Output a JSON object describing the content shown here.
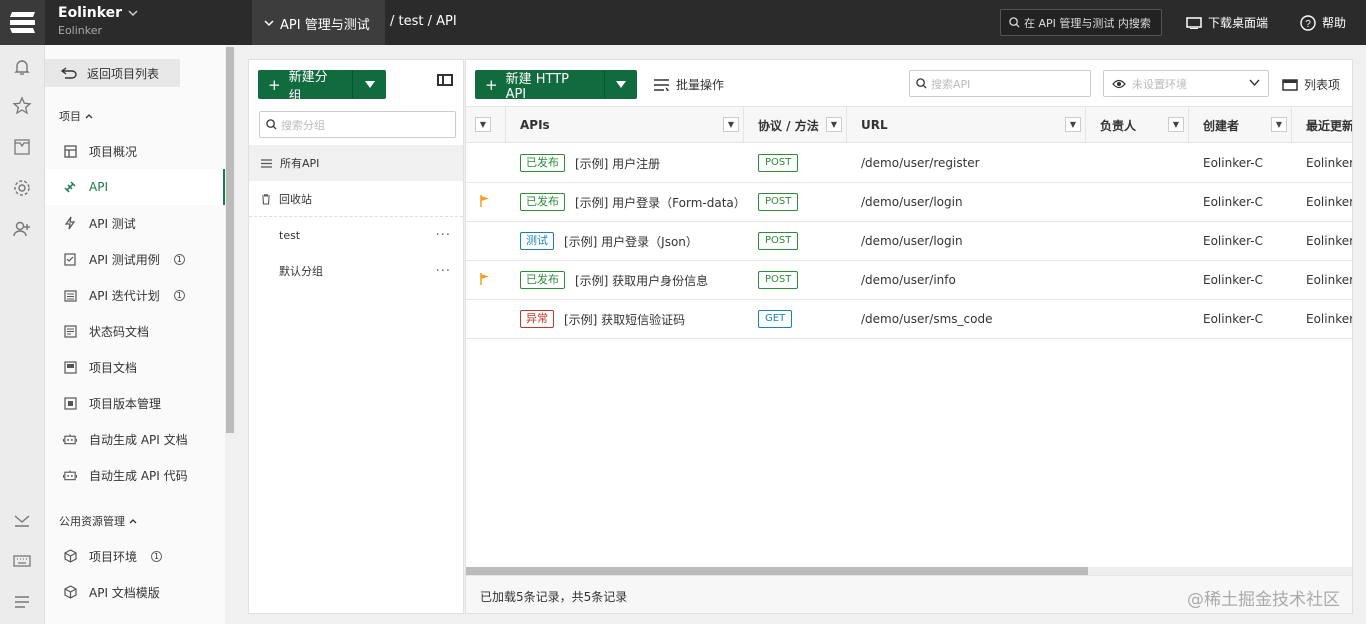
{
  "topbar": {
    "brand_name": "Eolinker",
    "brand_sub": "Eolinker",
    "crumb_active": "API 管理与测试",
    "crumb_rest": "/ test / API",
    "search_placeholder": "在 API 管理与测试 内搜索",
    "download_label": "下载桌面端",
    "help_label": "帮助"
  },
  "nav": {
    "back_label": "返回项目列表",
    "section_project": "项目",
    "items": [
      {
        "label": "项目概况",
        "icon": "overview-icon"
      },
      {
        "label": "API",
        "icon": "api-icon",
        "active": true
      },
      {
        "label": "API 测试",
        "icon": "lightning-icon"
      },
      {
        "label": "API 测试用例",
        "icon": "checklist-icon",
        "info": "1"
      },
      {
        "label": "API 迭代计划",
        "icon": "calendar-icon",
        "info": "1"
      },
      {
        "label": "状态码文档",
        "icon": "doc-icon"
      },
      {
        "label": "项目文档",
        "icon": "book-icon"
      },
      {
        "label": "项目版本管理",
        "icon": "version-icon"
      },
      {
        "label": "自动生成 API 文档",
        "icon": "robot-icon"
      },
      {
        "label": "自动生成 API 代码",
        "icon": "robot-icon"
      }
    ],
    "section_public": "公用资源管理",
    "public_items": [
      {
        "label": "项目环境",
        "icon": "cube-icon",
        "info": "1"
      },
      {
        "label": "API 文档模版",
        "icon": "cube-icon"
      }
    ]
  },
  "groups": {
    "new_group_label": "新建分组",
    "search_placeholder": "搜索分组",
    "all_api": "所有API",
    "recycle": "回收站",
    "list": [
      "test",
      "默认分组"
    ],
    "more": "···"
  },
  "api": {
    "new_api_label": "新建 HTTP API",
    "batch_label": "批量操作",
    "search_placeholder": "搜索API",
    "env_placeholder": "未设置环境",
    "list_toggle": "列表项",
    "columns": [
      "APIs",
      "协议 / 方法",
      "URL",
      "负责人",
      "创建者",
      "最近更新"
    ],
    "rows": [
      {
        "flag": false,
        "status": "已发布",
        "status_type": "pub",
        "name": "[示例] 用户注册",
        "method": "POST",
        "url": "/demo/user/register",
        "creator": "Eolinker-C",
        "updated": "Eolinker-"
      },
      {
        "flag": true,
        "status": "已发布",
        "status_type": "pub",
        "name": "[示例] 用户登录（Form-data）",
        "method": "POST",
        "url": "/demo/user/login",
        "creator": "Eolinker-C",
        "updated": "Eolinker-"
      },
      {
        "flag": false,
        "status": "测试",
        "status_type": "test",
        "name": "[示例] 用户登录（Json）",
        "method": "POST",
        "url": "/demo/user/login",
        "creator": "Eolinker-C",
        "updated": "Eolinker-"
      },
      {
        "flag": true,
        "status": "已发布",
        "status_type": "pub",
        "name": "[示例] 获取用户身份信息",
        "method": "POST",
        "url": "/demo/user/info",
        "creator": "Eolinker-C",
        "updated": "Eolinker-"
      },
      {
        "flag": false,
        "status": "异常",
        "status_type": "err",
        "name": "[示例] 获取短信验证码",
        "method": "GET",
        "url": "/demo/user/sms_code",
        "creator": "Eolinker-C",
        "updated": "Eolinker-"
      }
    ],
    "footer": "已加载5条记录，共5条记录"
  },
  "watermark": "@稀土掘金技术社区",
  "colors": {
    "accent": "#116b3e",
    "topbar": "#2b2b2b",
    "published": "#2e8b3a",
    "testing": "#1e7fb8",
    "error": "#c0392b",
    "flag": "#f0a020"
  }
}
